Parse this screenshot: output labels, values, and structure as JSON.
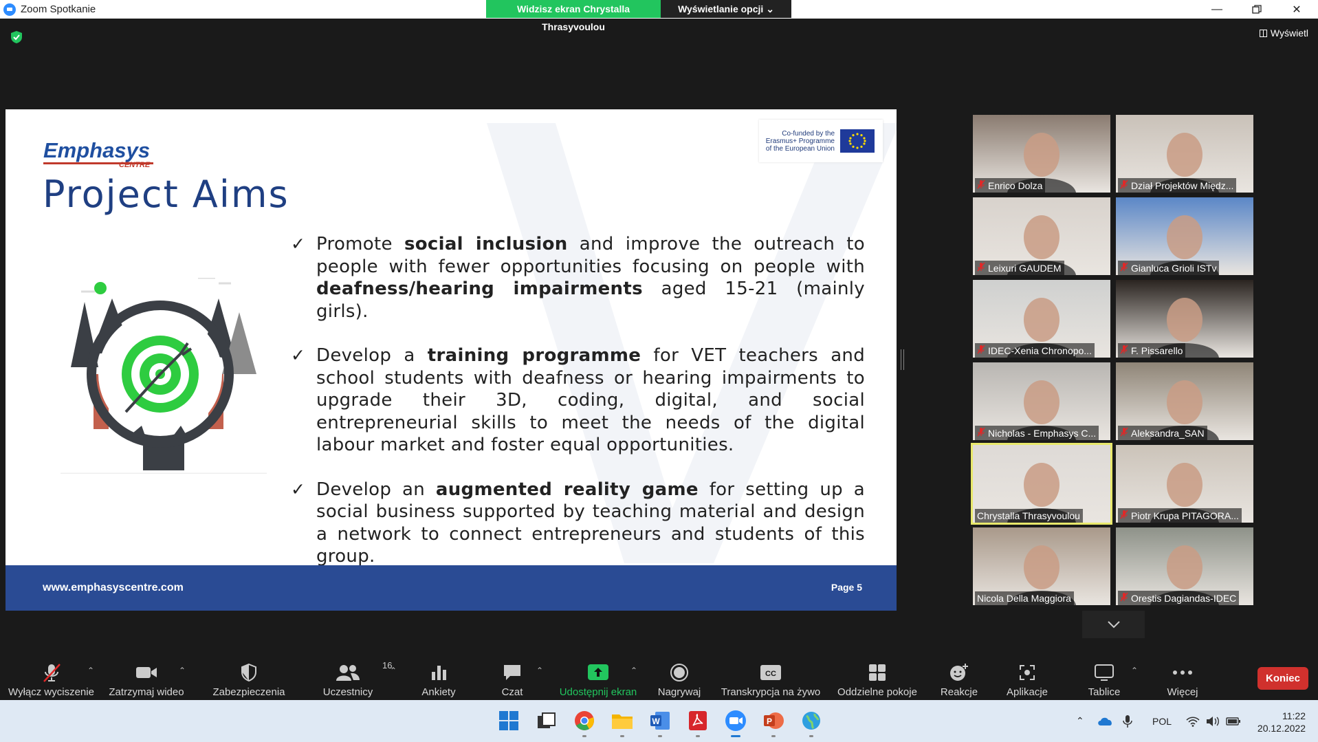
{
  "window": {
    "title": "Zoom Spotkanie",
    "share_banner": "Widzisz ekran Chrystalla Thrasyvoulou",
    "view_options": "Wyświetlanie opcji",
    "view_button": "Wyświetl"
  },
  "slide": {
    "logo_main": "Emphasys",
    "logo_sub": "CENTRE",
    "eu_text": [
      "Co-funded by the",
      "Erasmus+ Programme",
      "of the European Union"
    ],
    "title": "Project Aims",
    "bullets": [
      {
        "parts": [
          [
            "Promote ",
            false
          ],
          [
            "social inclusion",
            true
          ],
          [
            " and improve the outreach to people with fewer opportunities focusing on people with ",
            false
          ],
          [
            "deafness/hearing impairments",
            true
          ],
          [
            " aged 15-21 (mainly girls).",
            false
          ]
        ]
      },
      {
        "parts": [
          [
            "Develop a ",
            false
          ],
          [
            "training programme",
            true
          ],
          [
            " for VET teachers and school students with deafness or hearing impairments to upgrade their 3D, coding, digital, and social entrepreneurial skills to meet the needs of the digital labour market and foster equal opportunities.",
            false
          ]
        ]
      },
      {
        "parts": [
          [
            "Develop an ",
            false
          ],
          [
            "augmented reality game",
            true
          ],
          [
            " for setting up a social business supported by teaching material and design a network to connect entrepreneurs and students of this group.",
            false
          ]
        ]
      }
    ],
    "footer_url": "www.emphasyscentre.com",
    "page": "Page 5"
  },
  "participants": [
    {
      "name": "Enrico Dolza",
      "muted": true,
      "bg": "#8a7b70"
    },
    {
      "name": "Dział Projektów Międz...",
      "muted": true,
      "bg": "#c9c1b8"
    },
    {
      "name": "Leixuri GAUDEM",
      "muted": true,
      "bg": "#d8d2cc"
    },
    {
      "name": "Gianluca Grioli ISTv",
      "muted": true,
      "bg": "#5b87c7"
    },
    {
      "name": "IDEC-Xenia Chronopo...",
      "muted": true,
      "bg": "#cfd0cf"
    },
    {
      "name": "F. Pissarello",
      "muted": true,
      "bg": "#2a2420"
    },
    {
      "name": "Nicholas - Emphasys C...",
      "muted": true,
      "bg": "#b9b6b2"
    },
    {
      "name": "Aleksandra_SAN",
      "muted": true,
      "bg": "#8f8577"
    },
    {
      "name": "Chrystalla Thrasyvoulou",
      "muted": false,
      "bg": "#dedad6"
    },
    {
      "name": "Piotr Krupa PITAGORA...",
      "muted": true,
      "bg": "#cbc3b9"
    },
    {
      "name": "Nicola Della Maggiora",
      "muted": false,
      "bg": "#a9998a"
    },
    {
      "name": "Orestis Dagiandas-IDEC",
      "muted": true,
      "bg": "#8e9289"
    }
  ],
  "toolbar": {
    "mute": "Wyłącz wyciszenie",
    "video": "Zatrzymaj wideo",
    "security": "Zabezpieczenia",
    "participants": "Uczestnicy",
    "participants_count": "16",
    "polls": "Ankiety",
    "chat": "Czat",
    "share": "Udostępnij ekran",
    "record": "Nagrywaj",
    "transcript": "Transkrypcja na żywo",
    "breakout": "Oddzielne pokoje",
    "reactions": "Reakcje",
    "apps": "Aplikacje",
    "whiteboards": "Tablice",
    "more": "Więcej",
    "end": "Koniec"
  },
  "taskbar": {
    "lang": "POL",
    "time": "11:22",
    "date": "20.12.2022"
  },
  "colors": {
    "accent_green": "#22c55e",
    "slide_blue": "#2a4b94",
    "end_red": "#d0312d"
  }
}
